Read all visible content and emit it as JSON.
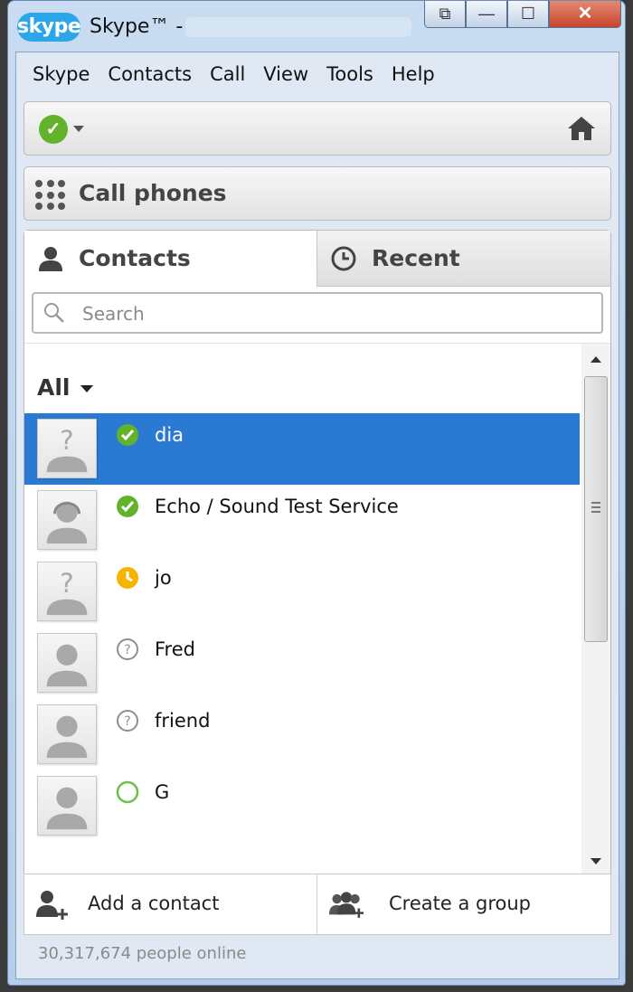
{
  "window": {
    "logo_text": "skype",
    "title": "Skype™ -",
    "controls": {
      "restore": "⧉",
      "minimize": "—",
      "maximize": "☐",
      "close": "✕"
    }
  },
  "menubar": {
    "items": [
      {
        "label": "Skype"
      },
      {
        "label": "Contacts"
      },
      {
        "label": "Call"
      },
      {
        "label": "View"
      },
      {
        "label": "Tools"
      },
      {
        "label": "Help"
      }
    ]
  },
  "status_bar": {
    "presence_glyph": "✓",
    "icons": {
      "presence": "online-status-icon",
      "home": "home-icon"
    }
  },
  "call_phones": {
    "label": "Call phones",
    "icon": "dialpad-icon"
  },
  "tabs": {
    "contacts": {
      "label": "Contacts",
      "icon": "person-icon"
    },
    "recent": {
      "label": "Recent",
      "icon": "clock-icon"
    }
  },
  "search": {
    "placeholder": "Search"
  },
  "contact_list": {
    "group_label": "All",
    "contacts": [
      {
        "name": "dia",
        "status": "online",
        "avatar": "unknown-avatar-icon",
        "selected": true
      },
      {
        "name": "Echo / Sound Test Service",
        "status": "online",
        "avatar": "headset-avatar-icon",
        "selected": false
      },
      {
        "name": "jo",
        "status": "away",
        "avatar": "unknown-avatar-icon",
        "selected": false
      },
      {
        "name": "Fred",
        "status": "pending",
        "avatar": "default-avatar-icon",
        "selected": false
      },
      {
        "name": "friend",
        "status": "pending",
        "avatar": "default-avatar-icon",
        "selected": false
      },
      {
        "name": "G",
        "status": "offline",
        "avatar": "default-avatar-icon",
        "selected": false
      }
    ]
  },
  "actions": {
    "add_contact": "Add a contact",
    "create_group": "Create a group"
  },
  "footer": {
    "online_count": "30,317,674 people online"
  },
  "colors": {
    "selected_row": "#2a7ad3",
    "online": "#62b32b",
    "away": "#f4b400",
    "pending": "#8e8e8e",
    "offline": "#6cc04a"
  }
}
